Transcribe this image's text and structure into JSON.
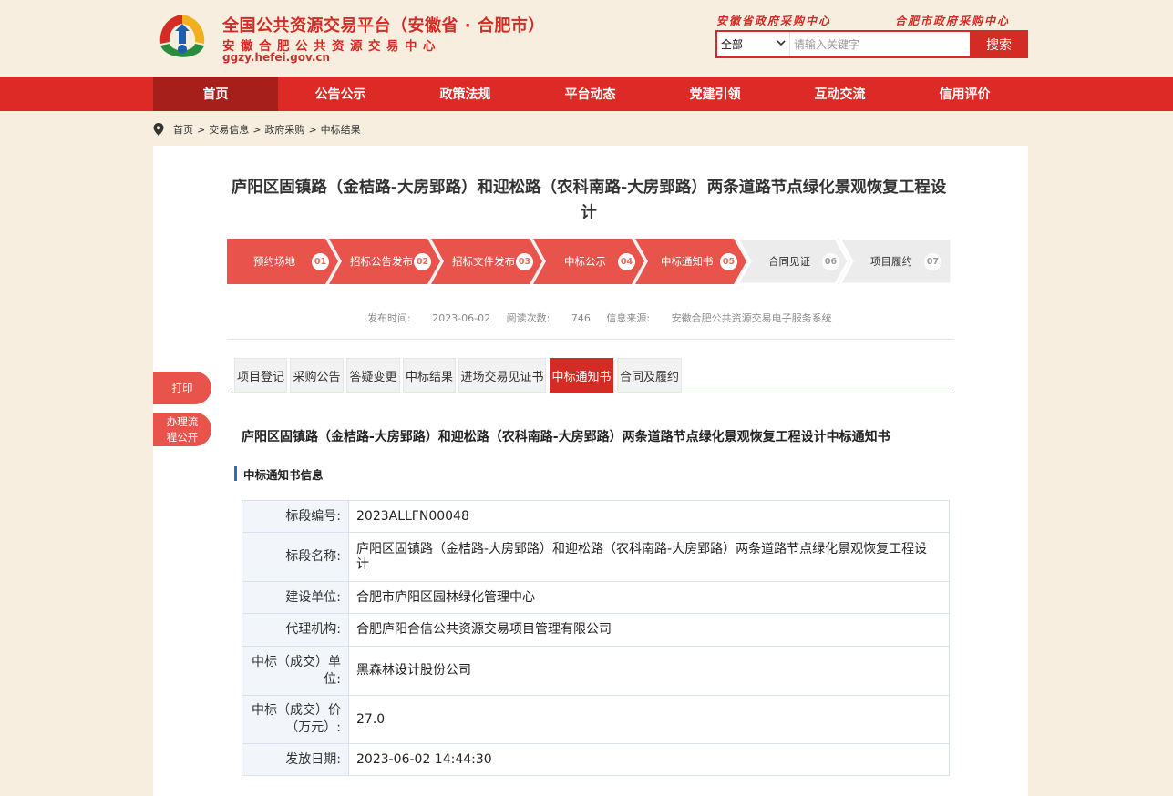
{
  "header": {
    "platform_title": "全国公共资源交易平台（安徽省 · 合肥市）",
    "center_name": "安徽合肥公共资源交易中心",
    "url": "ggzy.hefei.gov.cn",
    "top_links": [
      "安徽省政府采购中心",
      "合肥市政府采购中心"
    ],
    "search": {
      "select_value": "全部",
      "placeholder": "请输入关键字",
      "button_label": "搜索"
    }
  },
  "nav": {
    "items": [
      "首页",
      "公告公示",
      "政策法规",
      "平台动态",
      "党建引领",
      "互动交流",
      "信用评价"
    ],
    "active_index": 0
  },
  "breadcrumb": [
    "首页",
    ">",
    "交易信息",
    ">",
    "政府采购",
    ">",
    "中标结果"
  ],
  "page": {
    "title": "庐阳区固镇路（金桔路-大房郢路）和迎松路（农科南路-大房郢路）两条道路节点绿化景观恢复工程设计"
  },
  "steps": [
    {
      "label": "预约场地",
      "num": "01",
      "done": true
    },
    {
      "label": "招标公告发布",
      "num": "02",
      "done": true
    },
    {
      "label": "招标文件发布",
      "num": "03",
      "done": true
    },
    {
      "label": "中标公示",
      "num": "04",
      "done": true
    },
    {
      "label": "中标通知书",
      "num": "05",
      "done": true
    },
    {
      "label": "合同见证",
      "num": "06",
      "done": false
    },
    {
      "label": "项目履约",
      "num": "07",
      "done": false
    }
  ],
  "meta": {
    "publish_label": "发布时间:",
    "publish_value": "2023-06-02",
    "views_label": "阅读次数:",
    "views_value": "746",
    "source_label": "信息来源:",
    "source_value": "安徽合肥公共资源交易电子服务系统"
  },
  "side": {
    "print_label": "打印",
    "process_label_1": "办理流",
    "process_label_2": "程公开"
  },
  "tabs": {
    "items": [
      "项目登记",
      "采购公告",
      "答疑变更",
      "中标结果",
      "进场交易见证书",
      "中标通知书",
      "合同及履约"
    ],
    "active_index": 5
  },
  "notice": {
    "title": "庐阳区固镇路（金桔路-大房郢路）和迎松路（农科南路-大房郢路）两条道路节点绿化景观恢复工程设计中标通知书",
    "section_title": "中标通知书信息",
    "rows": [
      {
        "key": "标段编号:",
        "value": "2023ALLFN00048"
      },
      {
        "key": "标段名称:",
        "value": "庐阳区固镇路（金桔路-大房郢路）和迎松路（农科南路-大房郢路）两条道路节点绿化景观恢复工程设计"
      },
      {
        "key": "建设单位:",
        "value": "合肥市庐阳区园林绿化管理中心"
      },
      {
        "key": "代理机构:",
        "value": "合肥庐阳合信公共资源交易项目管理有限公司"
      },
      {
        "key": "中标（成交）单位:",
        "value": "黑森林设计股份公司"
      },
      {
        "key": "中标（成交）价（万元）:",
        "value": "27.0"
      },
      {
        "key": "发放日期:",
        "value": "2023-06-02 14:44:30"
      }
    ]
  },
  "colors": {
    "brand_red": "#d52b25",
    "nav_active": "#a61f1b",
    "step_done": "#e8534c",
    "step_todo": "#f0f0f0",
    "section_bar": "#2f6cb3"
  },
  "icons": [
    "platform-logo-icon",
    "location-pin-icon",
    "chevron-down-icon"
  ]
}
